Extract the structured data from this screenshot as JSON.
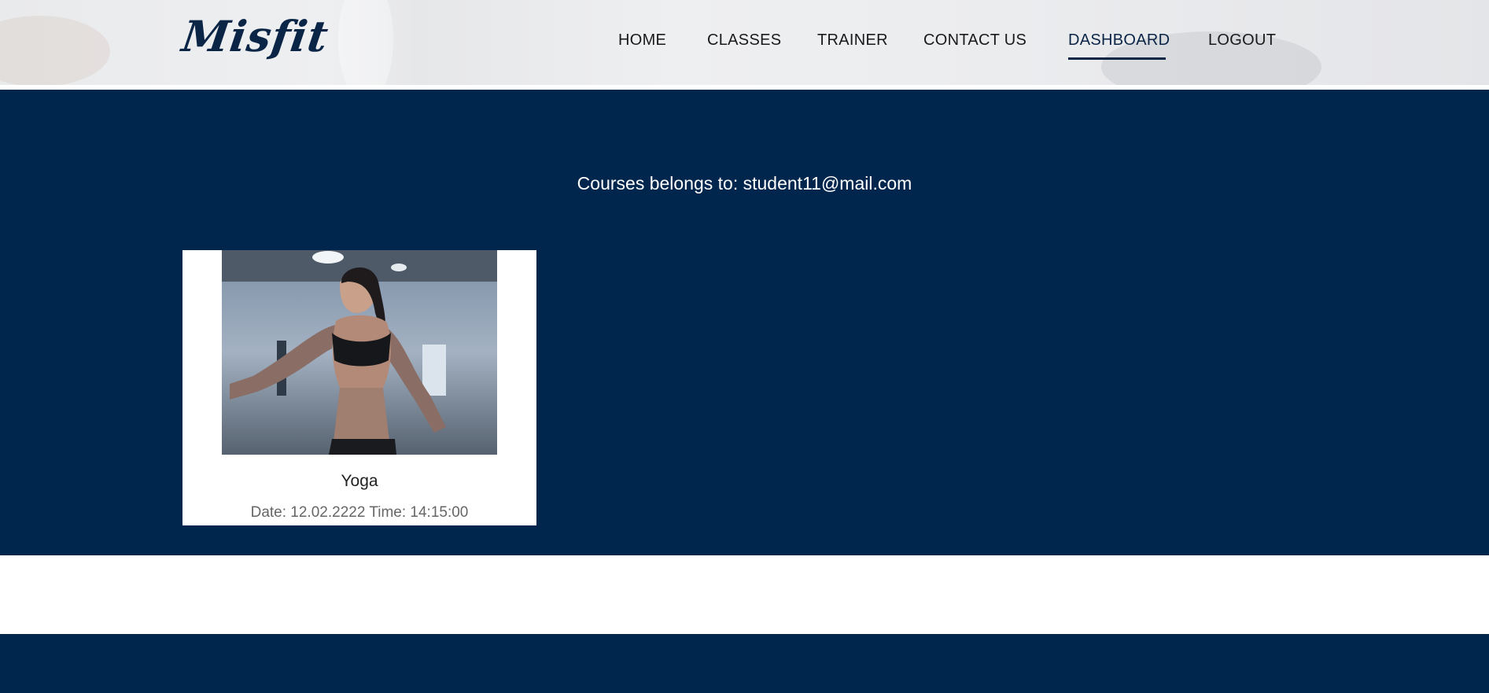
{
  "brand": {
    "logo_text": "Misfit"
  },
  "nav": {
    "items": [
      {
        "label": "HOME"
      },
      {
        "label": "CLASSES"
      },
      {
        "label": "TRAINER"
      },
      {
        "label": "CONTACT US"
      },
      {
        "label": "DASHBOARD",
        "active": true
      },
      {
        "label": "LOGOUT"
      }
    ]
  },
  "dashboard": {
    "owner_label": "Courses belongs to: student11@mail.com",
    "courses": [
      {
        "title": "Yoga",
        "schedule": "Date: 12.02.2222 Time: 14:15:00"
      }
    ]
  },
  "colors": {
    "primary_navy": "#00264d",
    "logo_navy": "#0b2547",
    "card_bg": "#ffffff"
  }
}
